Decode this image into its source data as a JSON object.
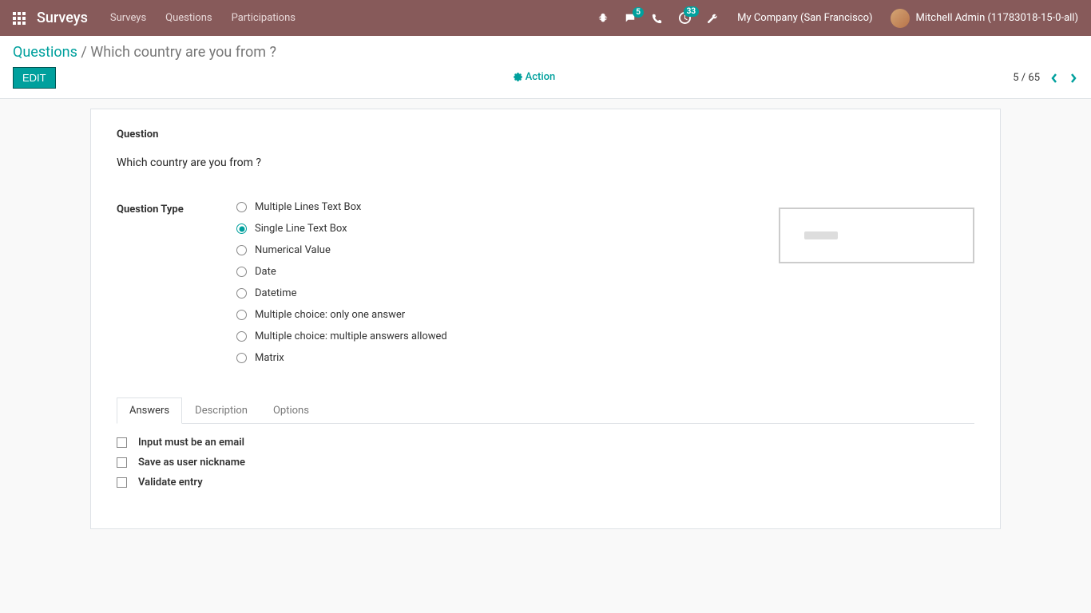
{
  "navbar": {
    "brand": "Surveys",
    "links": [
      "Surveys",
      "Questions",
      "Participations"
    ],
    "messages_badge": "5",
    "activities_badge": "33",
    "company": "My Company (San Francisco)",
    "user": "Mitchell Admin (11783018-15-0-all)"
  },
  "breadcrumb": {
    "parent": "Questions",
    "separator": " / ",
    "current": "Which country are you from ?"
  },
  "controls": {
    "edit_label": "EDIT",
    "action_label": "Action",
    "pager": "5 / 65"
  },
  "form": {
    "section_label": "Question",
    "question_text": "Which country are you from ?",
    "type_label": "Question Type",
    "types": [
      {
        "label": "Multiple Lines Text Box",
        "selected": false
      },
      {
        "label": "Single Line Text Box",
        "selected": true
      },
      {
        "label": "Numerical Value",
        "selected": false
      },
      {
        "label": "Date",
        "selected": false
      },
      {
        "label": "Datetime",
        "selected": false
      },
      {
        "label": "Multiple choice: only one answer",
        "selected": false
      },
      {
        "label": "Multiple choice: multiple answers allowed",
        "selected": false
      },
      {
        "label": "Matrix",
        "selected": false
      }
    ],
    "tabs": [
      "Answers",
      "Description",
      "Options"
    ],
    "active_tab": 0,
    "answers_checks": [
      {
        "label": "Input must be an email",
        "checked": false
      },
      {
        "label": "Save as user nickname",
        "checked": false
      },
      {
        "label": "Validate entry",
        "checked": false
      }
    ]
  }
}
